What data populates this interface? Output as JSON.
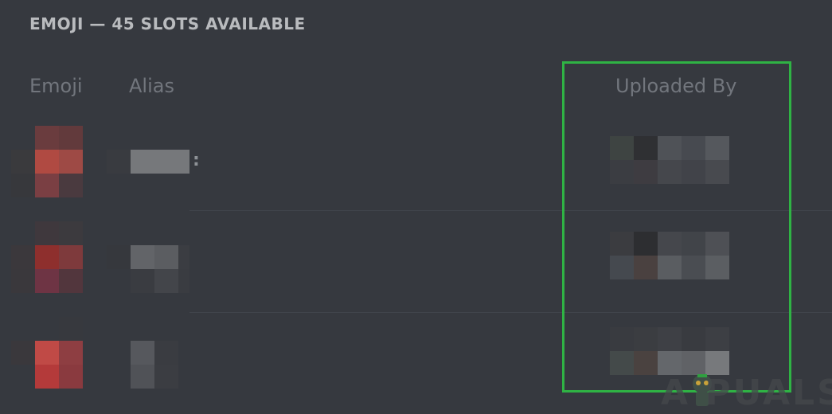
{
  "section": {
    "title": "EMOJI — 45 SLOTS AVAILABLE"
  },
  "columns": {
    "emoji": "Emoji",
    "alias": "Alias",
    "uploaded_by": "Uploaded By"
  },
  "rows": [
    {
      "alias_suffix": ":",
      "emoji_redacted": true,
      "alias_redacted": true,
      "uploader_redacted": true
    },
    {
      "alias_suffix": "",
      "emoji_redacted": true,
      "alias_redacted": true,
      "uploader_redacted": true
    },
    {
      "alias_suffix": "",
      "emoji_redacted": true,
      "alias_redacted": true,
      "uploader_redacted": true
    }
  ],
  "highlight": {
    "color": "#2fb344"
  },
  "watermark": {
    "text": "A PUALS"
  },
  "colors": {
    "background": "#36393f",
    "title": "#b9bbbe",
    "header": "#72767d"
  }
}
